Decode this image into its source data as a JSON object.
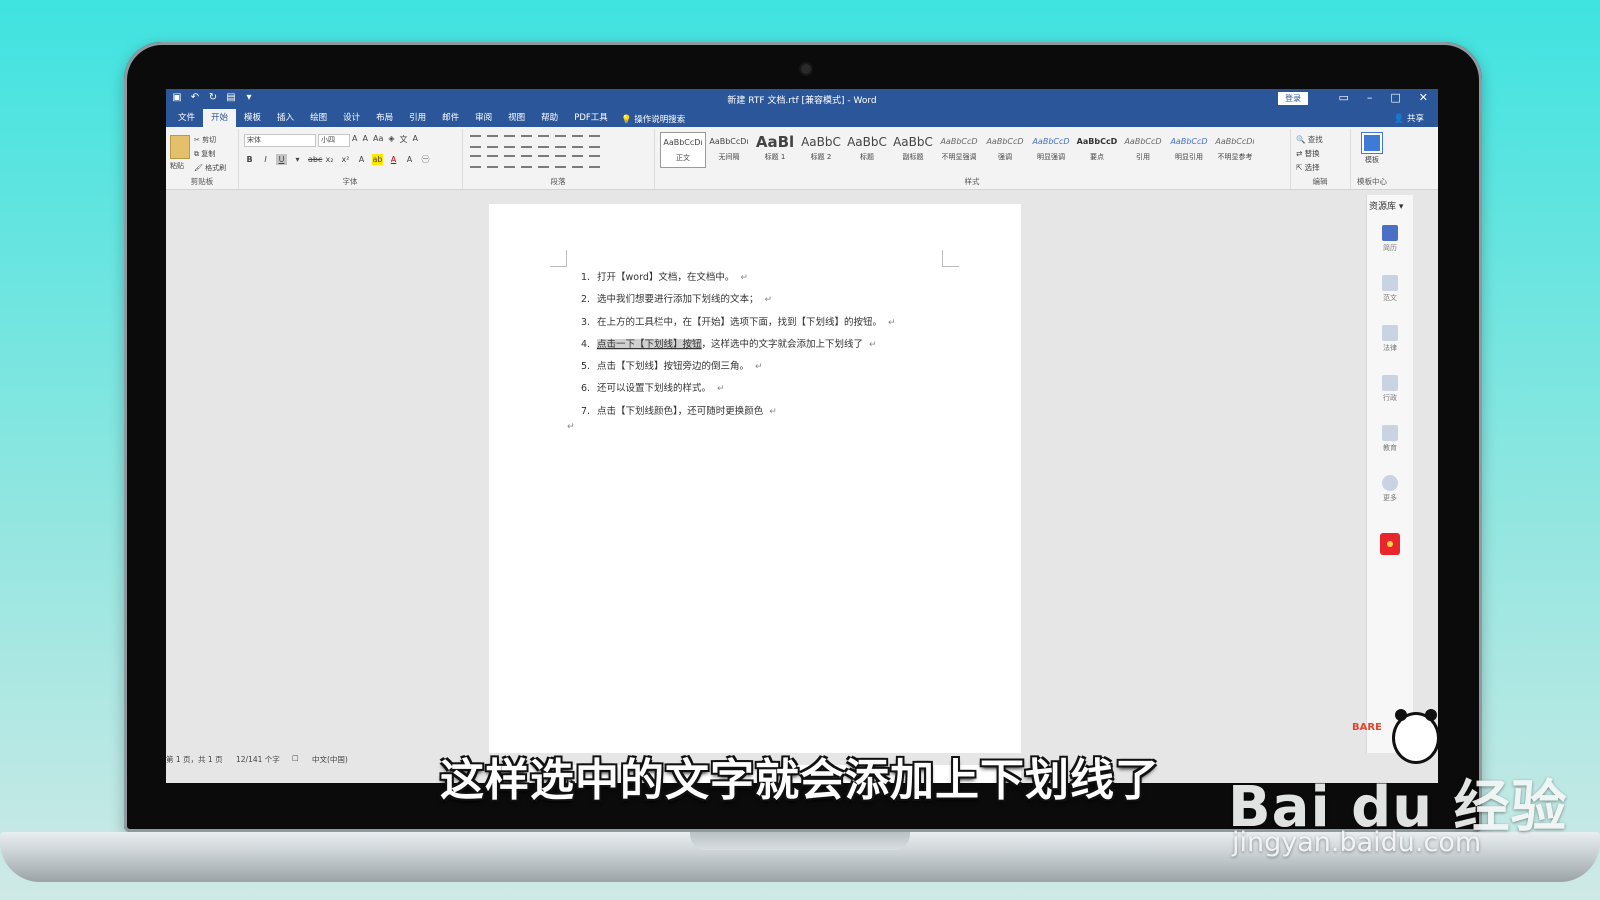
{
  "window": {
    "title": "新建 RTF 文档.rtf [兼容模式] - Word",
    "signin": "登录",
    "share": "共享",
    "tellme": "操作说明搜索"
  },
  "menu_tabs": [
    "文件",
    "开始",
    "模板",
    "插入",
    "绘图",
    "设计",
    "布局",
    "引用",
    "邮件",
    "审阅",
    "视图",
    "帮助",
    "PDF工具"
  ],
  "active_tab": "开始",
  "ribbon": {
    "clipboard": {
      "paste": "粘贴",
      "cut": "剪切",
      "copy": "复制",
      "format_painter": "格式刷",
      "label": "剪贴板"
    },
    "font": {
      "font_name": "宋体",
      "font_size": "小四",
      "label": "字体",
      "bold": "B",
      "italic": "I",
      "underline": "U",
      "strike": "abc",
      "sub": "x₂",
      "sup": "x²",
      "grow": "A",
      "shrink": "A",
      "case": "Aa"
    },
    "paragraph": {
      "label": "段落"
    },
    "styles": {
      "label": "样式",
      "items": [
        {
          "sample": "AaBbCcDı",
          "name": "正文"
        },
        {
          "sample": "AaBbCcDı",
          "name": "无间隔"
        },
        {
          "sample": "AaBl",
          "name": "标题 1"
        },
        {
          "sample": "AaBbC",
          "name": "标题 2"
        },
        {
          "sample": "AaBbC",
          "name": "标题"
        },
        {
          "sample": "AaBbC",
          "name": "副标题"
        },
        {
          "sample": "AaBbCcD",
          "name": "不明显强调"
        },
        {
          "sample": "AaBbCcD",
          "name": "强调"
        },
        {
          "sample": "AaBbCcD",
          "name": "明显强调"
        },
        {
          "sample": "AaBbCcD",
          "name": "要点"
        },
        {
          "sample": "AaBbCcD",
          "name": "引用"
        },
        {
          "sample": "AaBbCcD",
          "name": "明显引用"
        },
        {
          "sample": "AaBbCcDı",
          "name": "不明显参考"
        }
      ]
    },
    "editing": {
      "find": "查找",
      "replace": "替换",
      "select": "选择",
      "label": "编辑"
    },
    "template": {
      "button": "模板",
      "label": "模板中心"
    }
  },
  "document": {
    "lines": [
      {
        "num": "1.",
        "pre": "",
        "sel": "",
        "text": "打开【word】文档，在文档中。"
      },
      {
        "num": "2.",
        "pre": "",
        "sel": "",
        "text": "选中我们想要进行添加下划线的文本；"
      },
      {
        "num": "3.",
        "pre": "",
        "sel": "",
        "text": "在上方的工具栏中，在【开始】选项下面，找到【下划线】的按钮。"
      },
      {
        "num": "4.",
        "pre": "",
        "sel": "点击一下【下划线】按钮",
        "text": "，这样选中的文字就会添加上下划线了"
      },
      {
        "num": "5.",
        "pre": "",
        "sel": "",
        "text": "点击【下划线】按钮旁边的倒三角。"
      },
      {
        "num": "6.",
        "pre": "",
        "sel": "",
        "text": "还可以设置下划线的样式。"
      },
      {
        "num": "7.",
        "pre": "",
        "sel": "",
        "text": "点击【下划线颜色】，还可随时更换颜色"
      }
    ],
    "paragraph_mark": "↵"
  },
  "status": {
    "page": "第 1 页，共 1 页",
    "words": "12/141 个字",
    "language": "中文(中国)"
  },
  "side_panel": {
    "title": "资源库 ▾",
    "items": [
      "简历",
      "范文",
      "法律",
      "行政",
      "教育",
      "更多"
    ]
  },
  "overlay": {
    "subtitle": "这样选中的文字就会添加上下划线了",
    "watermark": "Bai du 经验",
    "watermark_url": "jingyan.baidu.com",
    "mascot_tag": "BARE"
  },
  "colors": {
    "word_blue": "#2b579a",
    "selection_gray": "#d0d0d0"
  }
}
